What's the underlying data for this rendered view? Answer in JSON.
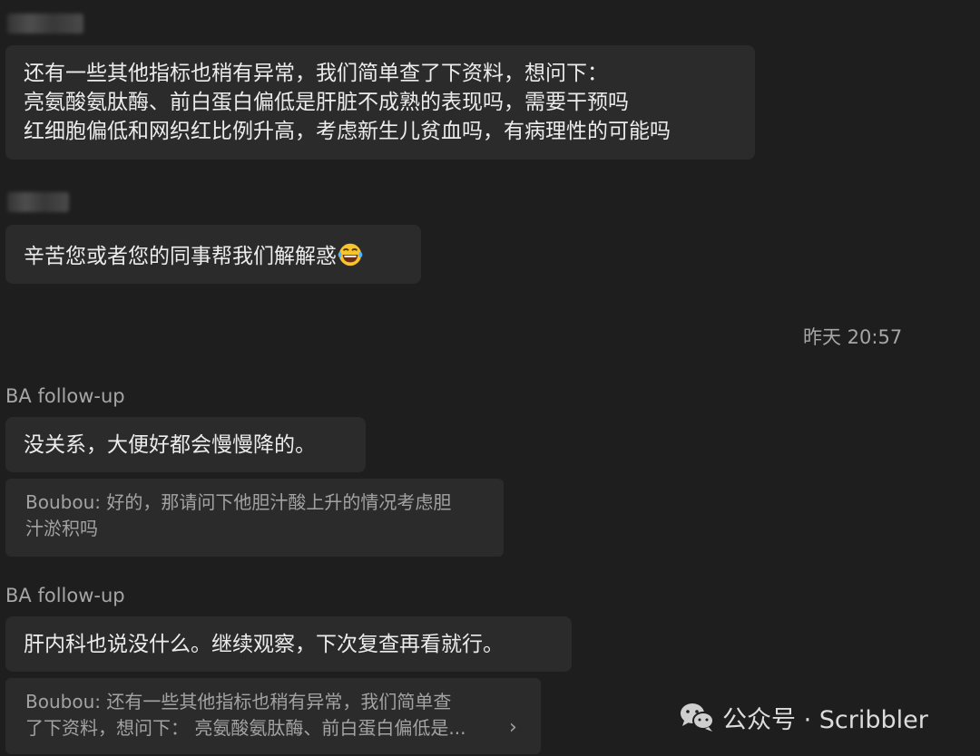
{
  "messages": [
    {
      "lines": [
        "还有一些其他指标也稍有异常，我们简单查了下资料，想问下：",
        "亮氨酸氨肽酶、前白蛋白偏低是肝脏不成熟的表现吗，需要干预吗",
        "红细胞偏低和网织红比例升高，考虑新生儿贫血吗，有病理性的可能吗"
      ]
    },
    {
      "text": "辛苦您或者您的同事帮我们解解惑",
      "emoji": "face-with-tears-of-joy"
    }
  ],
  "timestamp": "昨天 20:57",
  "replies": [
    {
      "sender": "BA follow-up",
      "text": "没关系，大便好都会慢慢降的。",
      "quote_lines": [
        "Boubou: 好的，那请问下他胆汁酸上升的情况考虑胆",
        "汁淤积吗"
      ]
    },
    {
      "sender": "BA follow-up",
      "text": "肝内科也说没什么。继续观察，下次复查再看就行。",
      "quote_lines": [
        "Boubou: 还有一些其他指标也稍有异常，我们简单查",
        "了下资料，想问下： 亮氨酸氨肽酶、前白蛋白偏低是..."
      ],
      "quote_more": "›"
    }
  ],
  "watermark": {
    "icon": "wechat-icon",
    "text": "公众号 · Scribbler"
  },
  "colors": {
    "background": "#1e1e1e",
    "bubble": "#2b2b2b",
    "text": "#ececec",
    "muted": "#a6a6a6"
  }
}
